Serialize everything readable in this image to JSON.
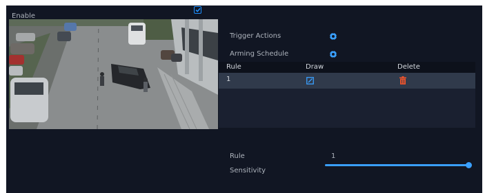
{
  "enable_label": "Enable",
  "enable_checked": true,
  "menu": {
    "trigger_actions": "Trigger Actions",
    "arming_schedule": "Arming Schedule"
  },
  "table": {
    "headers": [
      "Rule",
      "Draw",
      "Delete"
    ],
    "rows": [
      {
        "rule": "1"
      }
    ]
  },
  "rule_field": {
    "label": "Rule",
    "value": "1"
  },
  "sensitivity": {
    "label": "Sensitivity",
    "value_fraction": 1.0
  },
  "colors": {
    "accent": "#3aa0ff",
    "delete": "#e8532d",
    "panel": "#111623"
  },
  "icons": {
    "enable": "checkbox-checked-icon",
    "trigger_actions": "gear-icon",
    "arming_schedule": "gear-icon",
    "draw": "edit-icon",
    "delete": "trash-icon"
  }
}
